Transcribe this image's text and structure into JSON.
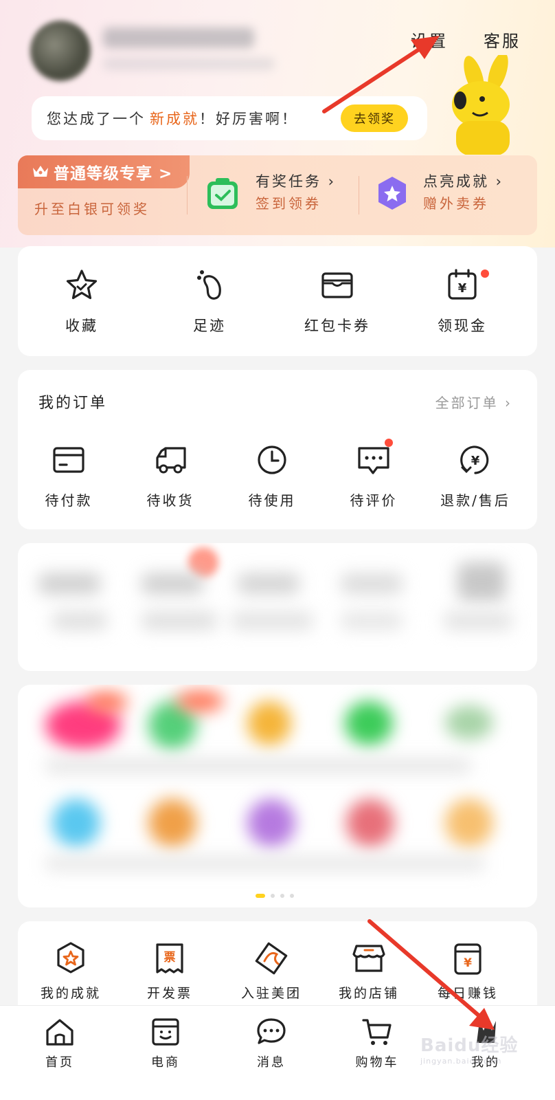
{
  "header": {
    "settings_label": "设置",
    "service_label": "客服",
    "achievement_text_prefix": "您达成了一个",
    "achievement_highlight": "新成就",
    "achievement_text_suffix": "！好厉害啊！",
    "claim_button": "去领奖"
  },
  "level_strip": {
    "level_title": "普通等级专享 >",
    "level_sub": "升至白银可领奖",
    "task_title": "有奖任务",
    "task_sub": "签到领券",
    "achieve_title": "点亮成就",
    "achieve_sub": "赠外卖券"
  },
  "quick_actions": [
    {
      "label": "收藏",
      "icon": "star-icon"
    },
    {
      "label": "足迹",
      "icon": "footprint-icon"
    },
    {
      "label": "红包卡券",
      "icon": "wallet-icon"
    },
    {
      "label": "领现金",
      "icon": "cash-calendar-icon"
    }
  ],
  "orders": {
    "title": "我的订单",
    "all_link": "全部订单",
    "items": [
      {
        "label": "待付款",
        "icon": "card-icon"
      },
      {
        "label": "待收货",
        "icon": "truck-icon"
      },
      {
        "label": "待使用",
        "icon": "clock-icon"
      },
      {
        "label": "待评价",
        "icon": "comment-icon"
      },
      {
        "label": "退款/售后",
        "icon": "refund-icon"
      }
    ]
  },
  "tools": [
    {
      "label": "我的成就",
      "icon": "medal-icon"
    },
    {
      "label": "开发票",
      "icon": "invoice-icon"
    },
    {
      "label": "入驻美团",
      "icon": "join-icon"
    },
    {
      "label": "我的店铺",
      "icon": "shop-icon"
    },
    {
      "label": "每日赚钱",
      "icon": "earn-icon"
    }
  ],
  "tabbar": [
    {
      "label": "首页",
      "icon": "home-icon"
    },
    {
      "label": "电商",
      "icon": "ecommerce-icon"
    },
    {
      "label": "消息",
      "icon": "message-icon"
    },
    {
      "label": "购物车",
      "icon": "cart-icon"
    },
    {
      "label": "我的",
      "icon": "profile-icon"
    }
  ],
  "watermark": {
    "brand": "Baidu经验",
    "url": "jingyan.baidu.com"
  },
  "colors": {
    "accent_orange": "#e8661b",
    "brand_yellow": "#ffd21f",
    "arrow_red": "#e8392a",
    "green": "#2dbe5a"
  }
}
